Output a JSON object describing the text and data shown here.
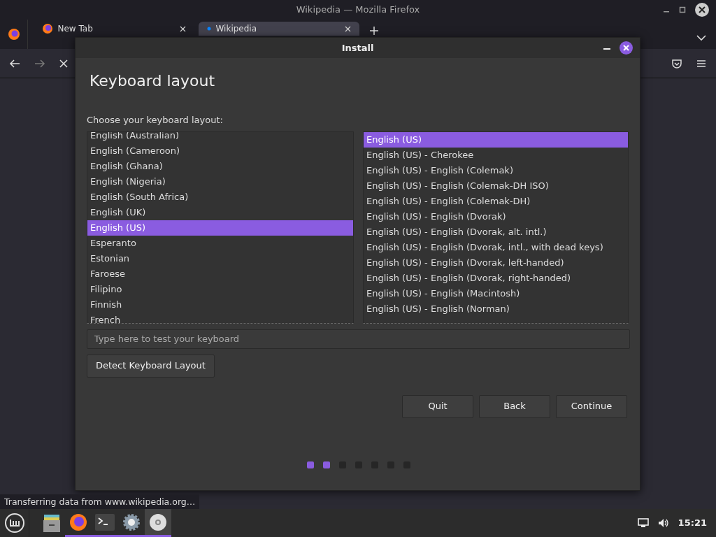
{
  "browser": {
    "title": "Wikipedia — Mozilla Firefox",
    "tabs": [
      {
        "label": "New Tab",
        "selected": false
      },
      {
        "label": "Wikipedia",
        "selected": true
      }
    ],
    "status": "Transferring data from www.wikipedia.org…"
  },
  "dialog": {
    "title": "Install",
    "heading": "Keyboard layout",
    "prompt": "Choose your keyboard layout:",
    "layouts": [
      {
        "label": "English (Australian)",
        "selected": false
      },
      {
        "label": "English (Cameroon)",
        "selected": false
      },
      {
        "label": "English (Ghana)",
        "selected": false
      },
      {
        "label": "English (Nigeria)",
        "selected": false
      },
      {
        "label": "English (South Africa)",
        "selected": false
      },
      {
        "label": "English (UK)",
        "selected": false
      },
      {
        "label": "English (US)",
        "selected": true
      },
      {
        "label": "Esperanto",
        "selected": false
      },
      {
        "label": "Estonian",
        "selected": false
      },
      {
        "label": "Faroese",
        "selected": false
      },
      {
        "label": "Filipino",
        "selected": false
      },
      {
        "label": "Finnish",
        "selected": false
      },
      {
        "label": "French",
        "selected": false
      }
    ],
    "variants": [
      {
        "label": "English (US)",
        "selected": true
      },
      {
        "label": "English (US) - Cherokee",
        "selected": false
      },
      {
        "label": "English (US) - English (Colemak)",
        "selected": false
      },
      {
        "label": "English (US) - English (Colemak-DH ISO)",
        "selected": false
      },
      {
        "label": "English (US) - English (Colemak-DH)",
        "selected": false
      },
      {
        "label": "English (US) - English (Dvorak)",
        "selected": false
      },
      {
        "label": "English (US) - English (Dvorak, alt. intl.)",
        "selected": false
      },
      {
        "label": "English (US) - English (Dvorak, intl., with dead keys)",
        "selected": false
      },
      {
        "label": "English (US) - English (Dvorak, left-handed)",
        "selected": false
      },
      {
        "label": "English (US) - English (Dvorak, right-handed)",
        "selected": false
      },
      {
        "label": "English (US) - English (Macintosh)",
        "selected": false
      },
      {
        "label": "English (US) - English (Norman)",
        "selected": false
      }
    ],
    "test_field": {
      "placeholder": "Type here to test your keyboard"
    },
    "detect_button": "Detect Keyboard Layout",
    "buttons": [
      "Quit",
      "Back",
      "Continue"
    ],
    "steps": [
      {
        "done": true
      },
      {
        "done": true
      },
      {
        "done": false
      },
      {
        "done": false
      },
      {
        "done": false
      },
      {
        "done": false
      },
      {
        "done": false
      }
    ]
  },
  "taskbar": {
    "clock": "15:21"
  }
}
